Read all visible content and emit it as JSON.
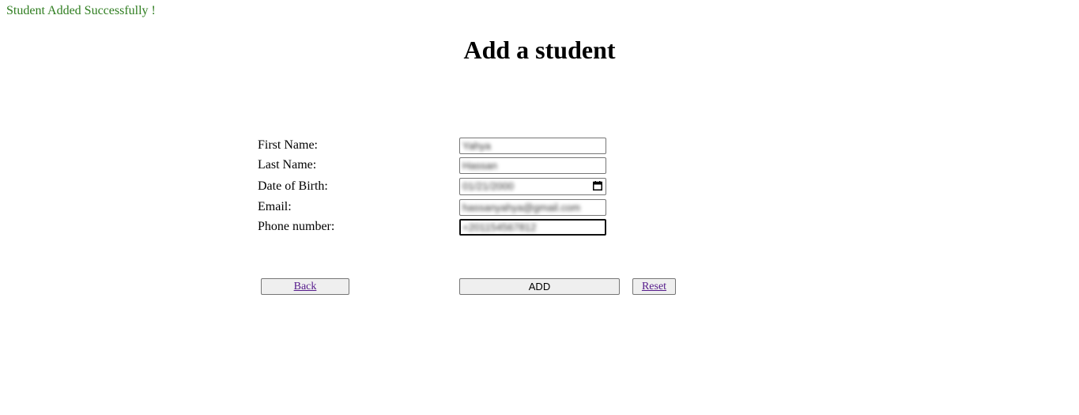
{
  "status_message": "Student Added Successfully !",
  "page_title": "Add a student",
  "form": {
    "fields": [
      {
        "label": "First Name:",
        "value": "Yahya"
      },
      {
        "label": "Last Name:",
        "value": "Hassan"
      },
      {
        "label": "Date of Birth:",
        "value": "01/21/2000"
      },
      {
        "label": "Email:",
        "value": "hassanyahya@gmail.com"
      },
      {
        "label": "Phone number:",
        "value": "+201154567812"
      }
    ]
  },
  "buttons": {
    "back": "Back",
    "add": "ADD",
    "reset": "Reset"
  },
  "colors": {
    "success": "#2e7d1f",
    "link": "#551a8b",
    "button_bg": "#efefef"
  }
}
